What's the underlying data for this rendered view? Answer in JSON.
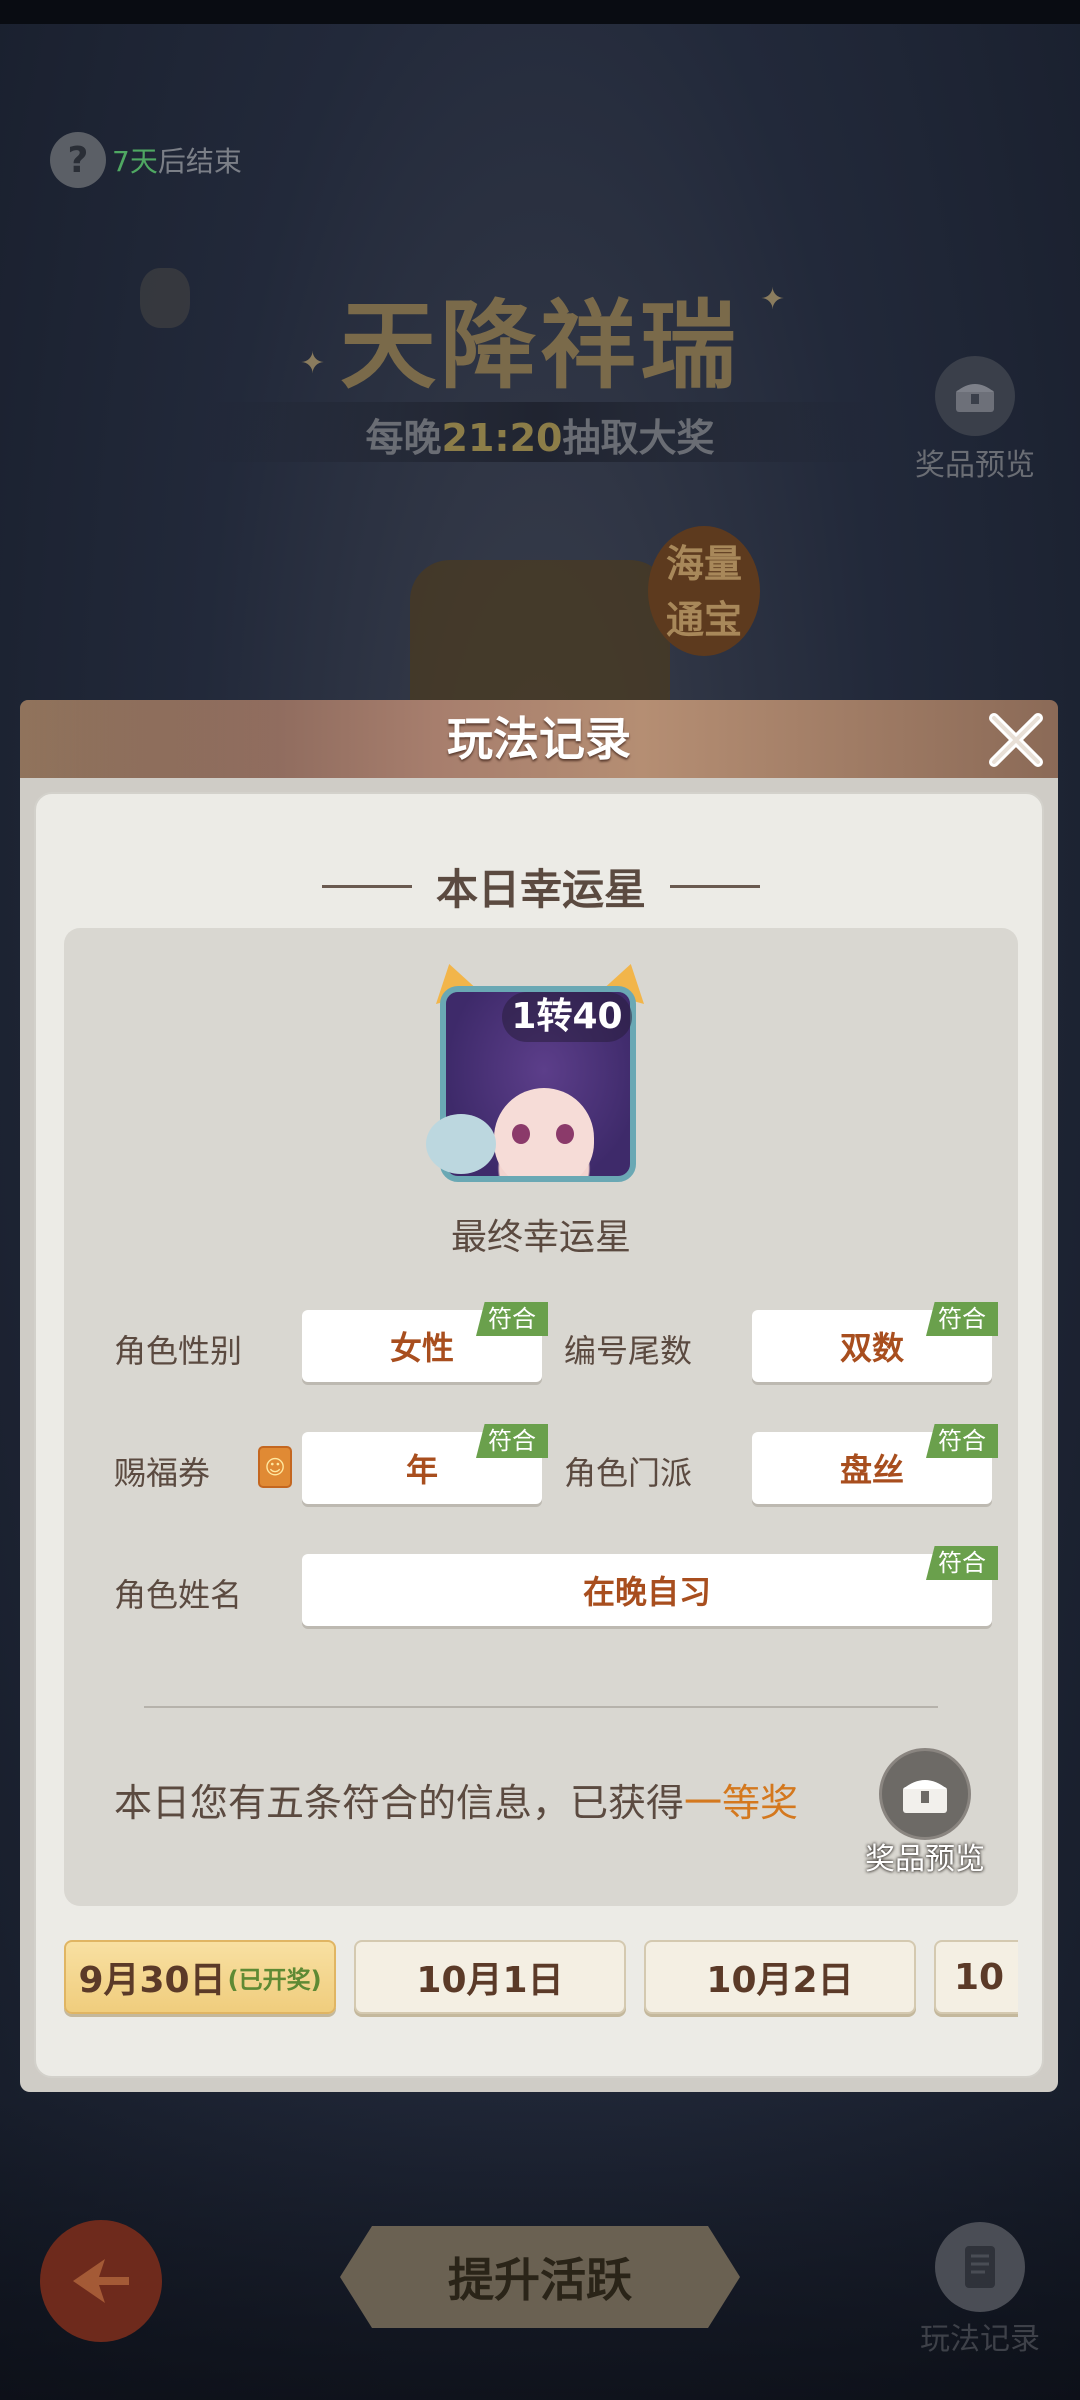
{
  "background": {
    "timer_days": "7天",
    "timer_suffix": "后结束",
    "title": "天降祥瑞",
    "subtitle_prefix": "每晚",
    "subtitle_time": "21:20",
    "subtitle_suffix": "抽取大奖",
    "prize_preview_label": "奖品预览",
    "badge_line1": "海量",
    "badge_line2": "通宝"
  },
  "bottom_bar": {
    "boost_label": "提升活跃",
    "record_label": "玩法记录"
  },
  "modal": {
    "title": "玩法记录",
    "section_title": "本日幸运星",
    "avatar_level": "1转40",
    "avatar_caption": "最终幸运星",
    "match_tag": "符合",
    "fields": [
      {
        "label": "角色性别",
        "value": "女性"
      },
      {
        "label": "编号尾数",
        "value": "双数"
      },
      {
        "label": "赐福券",
        "value": "年"
      },
      {
        "label": "角色门派",
        "value": "盘丝"
      },
      {
        "label": "角色姓名",
        "value": "在晚自习"
      }
    ],
    "result_text": "本日您有五条符合的信息，已获得",
    "result_prize": "一等奖",
    "prize_preview_label": "奖品预览",
    "dates": [
      {
        "label": "9月30日",
        "status": "(已开奖)"
      },
      {
        "label": "10月1日",
        "status": ""
      },
      {
        "label": "10月2日",
        "status": ""
      },
      {
        "label": "10",
        "status": ""
      }
    ]
  },
  "colors": {
    "accent_orange": "#d4781e",
    "match_green": "#6aa04c",
    "value_brown": "#a84e1e"
  },
  "icons": [
    "help-icon",
    "chest-icon",
    "close-icon",
    "back-arrow-icon",
    "scroll-icon",
    "coupon-icon"
  ]
}
